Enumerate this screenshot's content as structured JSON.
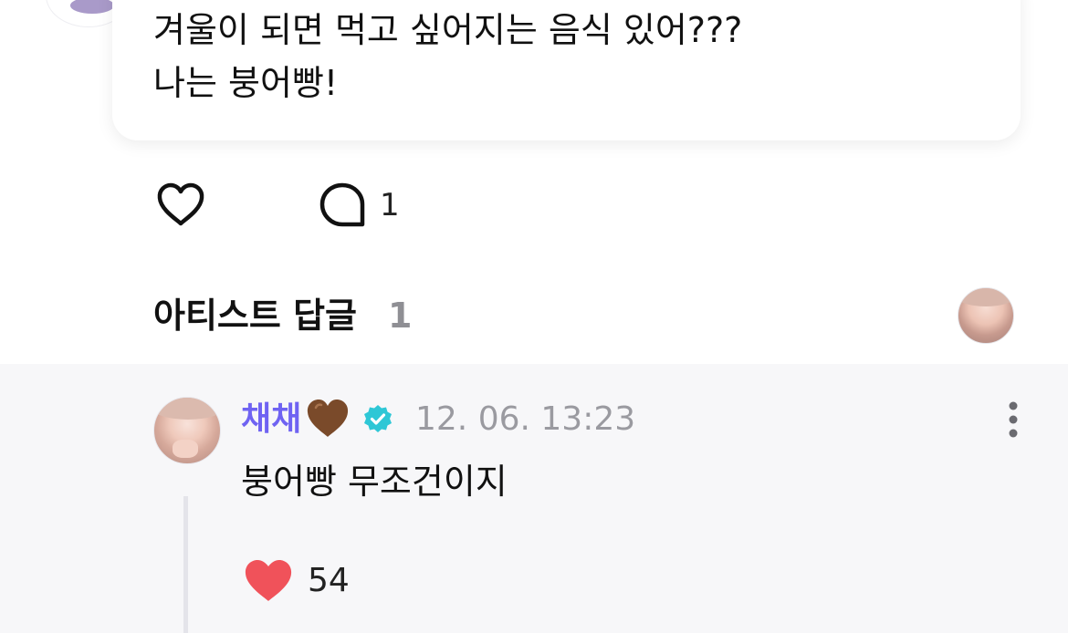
{
  "post": {
    "text_lines": [
      "겨울이 되면 먹고 싶어지는 음식 있어???",
      "나는 붕어빵!"
    ],
    "comment_count": "1"
  },
  "artist_replies": {
    "title": "아티스트 답글",
    "count": "1"
  },
  "reply": {
    "author": "채채",
    "timestamp": "12. 06. 13:23",
    "text": "붕어빵 무조건이지",
    "like_count": "54"
  },
  "colors": {
    "author": "#6f63f2",
    "verified": "#2ec7d6",
    "liked_heart": "#f0525a",
    "brown_heart": "#7a4a2a",
    "reply_background": "#f7f7f9"
  },
  "icons": {
    "like": "heart-outline-icon",
    "comment": "speech-bubble-icon",
    "reply_like": "heart-filled-icon",
    "author_emoji": "brown-heart-icon",
    "badge": "verified-badge-icon",
    "menu": "more-vertical-icon"
  }
}
